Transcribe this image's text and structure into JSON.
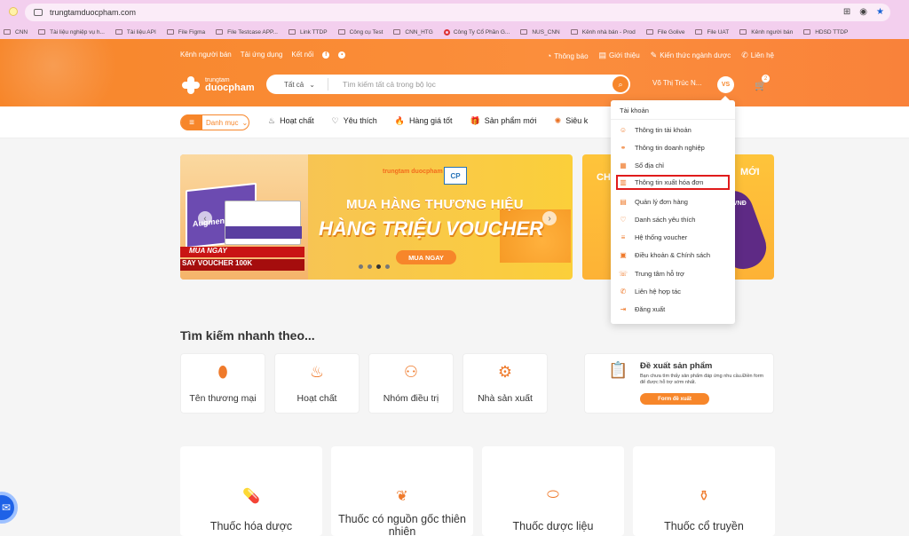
{
  "browser": {
    "url": "trungtamduocpham.com",
    "bookmarks": [
      "CNN",
      "Tài liệu nghiệp vụ h...",
      "Tài liệu API",
      "File Figma",
      "File Testcase APP...",
      "Link TTDP",
      "Công cụ Test",
      "CNN_HTG",
      "Công Ty Cổ Phần G...",
      "NUS_CNN",
      "Kênh nhà bán - Prod",
      "File Golive",
      "File UAT",
      "Kênh người bán",
      "HDSD TTDP"
    ]
  },
  "header": {
    "toplinks": [
      "Kênh người bán",
      "Tải ứng dụng",
      "Kết nối"
    ],
    "rightlinks": [
      "Thông báo",
      "Giới thiệu",
      "Kiến thức ngành dược",
      "Liên hệ"
    ],
    "logo_line1": "trungtam",
    "logo_line2": "duocpham",
    "search_category": "Tất cả",
    "search_placeholder": "Tìm kiếm tất cả trong bộ lọc",
    "user_name": "Võ Thị Trúc N...",
    "avatar_text": "VS",
    "cart_count": "2"
  },
  "nav": {
    "menu_label": "Danh mục",
    "items": [
      "Hoạt chất",
      "Yêu thích",
      "Hàng giá tốt",
      "Sản phẩm mới",
      "Siêu k"
    ]
  },
  "banner": {
    "box_label": "Augmentin",
    "ribbon1": "MUA NGAY",
    "ribbon2": "SAY VOUCHER 100K",
    "logo_text": "trungtam duocpham",
    "partner": "CP",
    "title1": "MUA HÀNG THƯƠNG HIỆU",
    "title2": "HÀNG TRIỆU VOUCHER",
    "button": "MUA NGAY",
    "side_left": "CH",
    "side_right": "MỚI",
    "side_vnd": "VNĐ"
  },
  "quick_search": {
    "title": "Tìm kiếm nhanh theo...",
    "cards": [
      "Tên thương mại",
      "Hoạt chất",
      "Nhóm điều trị",
      "Nhà sản xuất"
    ],
    "suggest_title": "Đề xuất sản phẩm",
    "suggest_desc": "Bạn chưa tìm thấy sản phẩm đáp ứng nhu cầu.Điền form để được hỗ trợ sớm nhất.",
    "suggest_button": "Form đề xuất"
  },
  "categories": [
    "Thuốc hóa dược",
    "Thuốc có nguồn gốc thiên nhiên",
    "Thuốc dược liệu",
    "Thuốc cổ truyền"
  ],
  "dropdown": {
    "header": "Tài khoản",
    "items": [
      "Thông tin tài khoản",
      "Thông tin doanh nghiệp",
      "Sổ địa chỉ",
      "Thông tin xuất hóa đơn",
      "Quản lý đơn hàng",
      "Danh sách yêu thích",
      "Hệ thống voucher",
      "Điều khoản & Chính sách",
      "Trung tâm hỗ trợ",
      "Liên hệ hợp tác",
      "Đăng xuất"
    ]
  }
}
